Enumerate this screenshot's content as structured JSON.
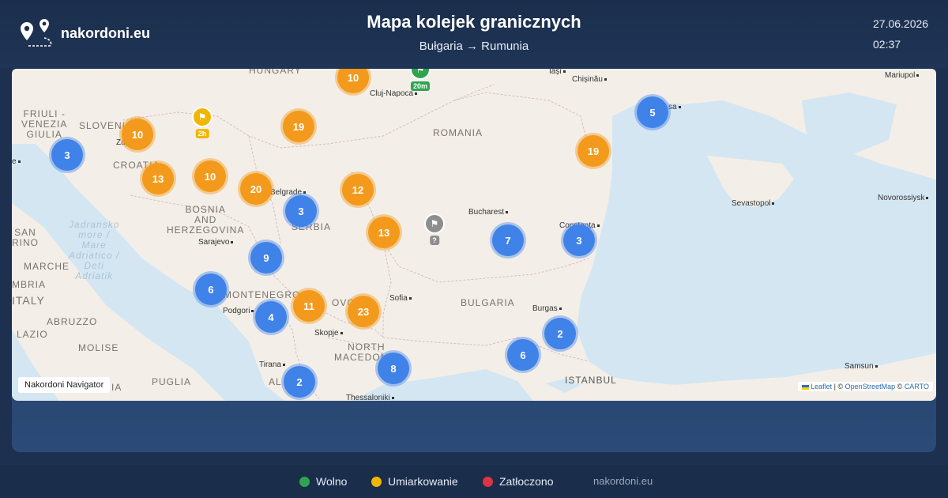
{
  "header": {
    "brand": "nakordoni.eu",
    "title": "Mapa kolejek granicznych",
    "subtitle": "Bułgaria → Rumunia",
    "date": "27.06.2026",
    "time": "02:37"
  },
  "map": {
    "navigator_label": "Nakordoni Navigator",
    "attribution": {
      "leaflet": "Leaflet",
      "sep1": " | © ",
      "osm": "OpenStreetMap",
      "sep2": " © ",
      "carto": "CARTO"
    },
    "regions": {
      "hungary": "HUNGARY",
      "slovenia": "SLOVENIA",
      "croatia": "CROATIA",
      "friuli1": "FRIULI -",
      "friuli2": "VENEZIA",
      "friuli3": "GIULIA",
      "bosnia1": "BOSNIA",
      "bosnia2": "AND",
      "bosnia3": "HERZEGOVINA",
      "serbia": "SERBIA",
      "romania": "ROMANIA",
      "bulgaria": "BULGARIA",
      "montenegro": "MONTENEGRO",
      "kosovo": "OVO",
      "northmac1": "NORTH",
      "northmac2": "MACEDONIA",
      "italy": "ITALY",
      "san": "SAN",
      "marino": "RINO",
      "marche": "MARCHE",
      "umbria": "MBRIA",
      "abruzzo": "ABRUZZO",
      "lazio": "LAZIO",
      "molise": "MOLISE",
      "puglia": "PUGLIA",
      "albania": "AL",
      "calabria": "IA"
    },
    "sea": {
      "l1": "Jadransko",
      "l2": "more /",
      "l3": "Mare",
      "l4": "Adriatico /",
      "l5": "Deti",
      "l6": "Adriatik"
    },
    "cities": {
      "iasi": "Iași",
      "chisinau": "Chișinău",
      "mariupol": "Mariupol",
      "cluj": "Cluj-Napoca",
      "odesa": "sa",
      "zagreb": "Zag",
      "belgrade": "Belgrade",
      "bucharest": "Bucharest",
      "sevastopol": "Sevastopol",
      "novorossiysk": "Novorossiysk",
      "constanta": "Constanța",
      "sarajevo": "Sarajevo",
      "sofia": "Sofia",
      "burgas": "Burgas",
      "podgorica": "Podgori",
      "skopje": "Skopje",
      "tirana": "Tirana",
      "istanbul": "ISTANBUL",
      "samsun": "Samsun",
      "thessaloniki": "Thessaloniki",
      "trieste": "e"
    },
    "clusters": [
      {
        "count": "10",
        "color": "orange"
      },
      {
        "count": "10",
        "color": "orange"
      },
      {
        "count": "19",
        "color": "orange"
      },
      {
        "count": "3",
        "color": "blue"
      },
      {
        "count": "13",
        "color": "orange"
      },
      {
        "count": "10",
        "color": "orange"
      },
      {
        "count": "20",
        "color": "orange"
      },
      {
        "count": "12",
        "color": "orange"
      },
      {
        "count": "3",
        "color": "blue"
      },
      {
        "count": "13",
        "color": "orange"
      },
      {
        "count": "9",
        "color": "blue"
      },
      {
        "count": "6",
        "color": "blue"
      },
      {
        "count": "11",
        "color": "orange"
      },
      {
        "count": "23",
        "color": "orange"
      },
      {
        "count": "4",
        "color": "blue"
      },
      {
        "count": "8",
        "color": "blue"
      },
      {
        "count": "2",
        "color": "blue"
      },
      {
        "count": "6",
        "color": "blue"
      },
      {
        "count": "2",
        "color": "blue"
      },
      {
        "count": "7",
        "color": "blue"
      },
      {
        "count": "3",
        "color": "blue"
      },
      {
        "count": "19",
        "color": "orange"
      },
      {
        "count": "5",
        "color": "blue"
      }
    ],
    "flags": [
      {
        "label": "20m",
        "color": "green"
      },
      {
        "label": "2h",
        "color": "yellow"
      },
      {
        "label": "?",
        "color": "grey"
      }
    ]
  },
  "legend": [
    {
      "label": "Wolno",
      "color": "#2ea44f"
    },
    {
      "label": "Umiarkowanie",
      "color": "#f2b600"
    },
    {
      "label": "Zatłoczono",
      "color": "#dc3545"
    }
  ],
  "footer": {
    "site": "nakordoni.eu"
  }
}
